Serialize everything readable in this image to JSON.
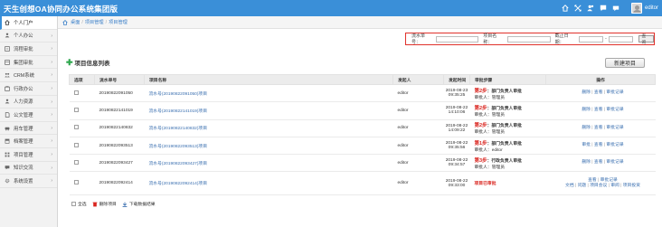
{
  "app": {
    "title": "天生创想OA协同办公系统集团版",
    "user": "editor"
  },
  "top_icons": [
    "home-icon",
    "expand-icon",
    "people-icon",
    "chat-icon",
    "message-icon"
  ],
  "sidebar": {
    "items": [
      {
        "label": "个人门户",
        "icon": "home-icon",
        "active": true
      },
      {
        "label": "个人办公",
        "icon": "person-icon"
      },
      {
        "label": "流程审批",
        "icon": "flow-icon"
      },
      {
        "label": "集团审批",
        "icon": "group-icon"
      },
      {
        "label": "CRM系统",
        "icon": "crm-icon"
      },
      {
        "label": "行政办公",
        "icon": "office-icon"
      },
      {
        "label": "人力资源",
        "icon": "hr-icon"
      },
      {
        "label": "公文管理",
        "icon": "doc-icon"
      },
      {
        "label": "用车管理",
        "icon": "car-icon"
      },
      {
        "label": "档案管理",
        "icon": "archive-icon"
      },
      {
        "label": "项目管理",
        "icon": "project-icon"
      },
      {
        "label": "知识交流",
        "icon": "knowledge-icon"
      },
      {
        "label": "系统设置",
        "icon": "settings-icon"
      }
    ]
  },
  "breadcrumb": [
    "桌面",
    "项目管理",
    "项目管理"
  ],
  "search": {
    "flow_label": "流水单号：",
    "project_label": "项目名称：",
    "deadline_label": "截止日期：",
    "dash": "-",
    "button": "查询"
  },
  "section": {
    "title": "项目信息列表",
    "new_button": "新建项目"
  },
  "table": {
    "headers": [
      "选项",
      "流水单号",
      "项目名称",
      "发起人",
      "发起时间",
      "审批步骤",
      "操作"
    ],
    "rows": [
      {
        "flow": "20190822091050",
        "name": "流水号(20190822091050)项目",
        "owner": "editor",
        "date": "2019-08-23",
        "time": "09:35:25",
        "step_num": "第2步",
        "step_desc": "：部门负责人审批",
        "step_sub": "审批人：管理员",
        "ops": [
          "删除",
          "查看",
          "审批记录"
        ]
      },
      {
        "flow": "20190822141019",
        "name": "流水号(20190822141019)项目",
        "owner": "editor",
        "date": "2019-08-22",
        "time": "14:10:06",
        "step_num": "第2步",
        "step_desc": "：部门负责人审批",
        "step_sub": "审批人：管理员",
        "ops": [
          "删除",
          "查看",
          "审批记录"
        ]
      },
      {
        "flow": "20190822140832",
        "name": "流水号(20190822140832)项目",
        "owner": "editor",
        "date": "2019-08-22",
        "time": "14:09:22",
        "step_num": "第2步",
        "step_desc": "：部门负责人审批",
        "step_sub": "审批人：管理员",
        "ops": [
          "删除",
          "查看",
          "审批记录"
        ]
      },
      {
        "flow": "20190822093513",
        "name": "流水号(20190822093513)项目",
        "owner": "editor",
        "date": "2019-08-22",
        "time": "09:35:56",
        "step_num": "第1步",
        "step_desc": "：部门负责人审批",
        "step_sub": "审批人：editor",
        "ops": [
          "审批",
          "查看",
          "审批记录"
        ]
      },
      {
        "flow": "20190822093427",
        "name": "流水号(20190822093427)项目",
        "owner": "editor",
        "date": "2019-08-22",
        "time": "09:34:57",
        "step_num": "第3步",
        "step_desc": "：行政负责人审批",
        "step_sub": "审批人：管理员",
        "ops": [
          "删除",
          "查看",
          "审批记录"
        ]
      },
      {
        "flow": "20190822092414",
        "name": "流水号(20190822092414)项目",
        "owner": "editor",
        "date": "2019-08-22",
        "time": "09:33:00",
        "status": "项目已审批",
        "ops": [
          "查看",
          "审批记录"
        ],
        "ops2": [
          "文档",
          "问题",
          "项目会议",
          "审阅",
          "项目投资"
        ]
      }
    ]
  },
  "footer": {
    "select_all": "全选",
    "delete_project": "删除项目",
    "download": "下载数据结果"
  },
  "colors": {
    "topbar": "#3a8fd8",
    "accent_red": "#d9231d",
    "link": "#3a6fb0",
    "highlight_border": "#e0312b"
  }
}
